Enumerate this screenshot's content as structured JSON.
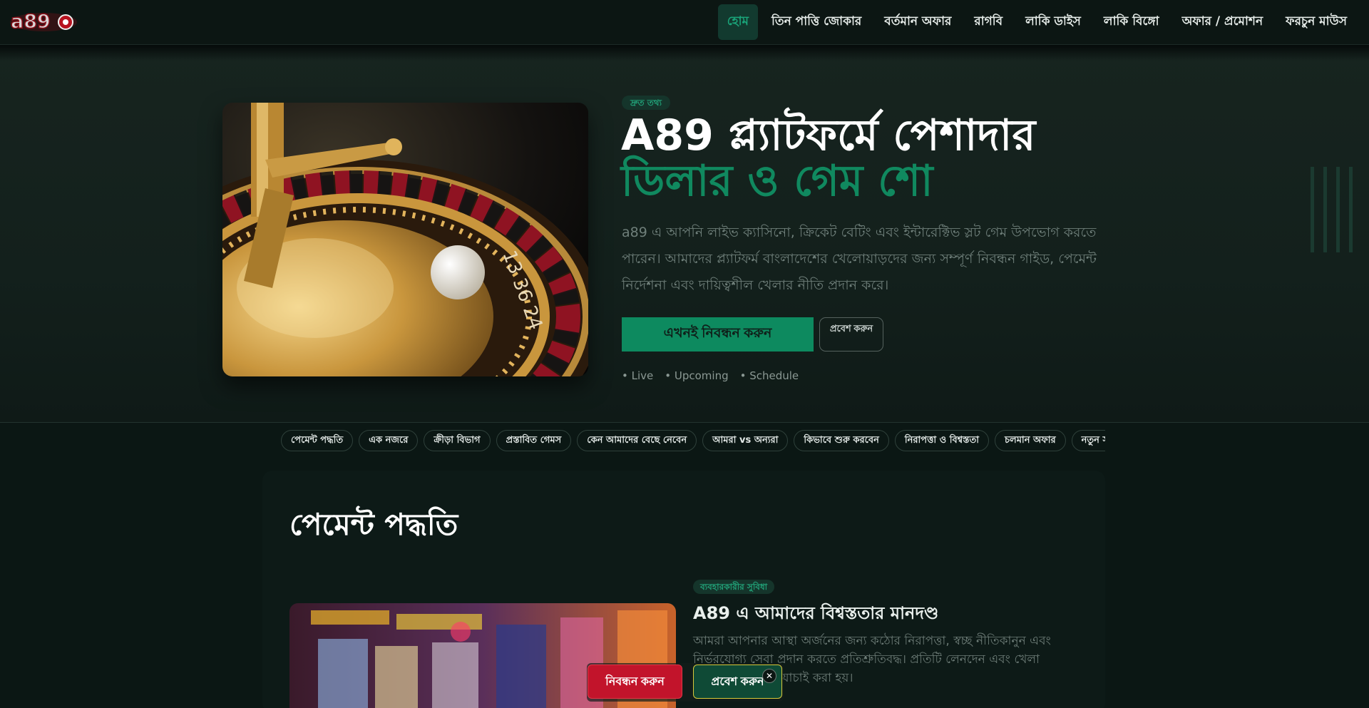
{
  "header": {
    "logo_text": "a89",
    "nav": [
      {
        "label": "হোম",
        "active": true
      },
      {
        "label": "তিন পাত্তি জোকার"
      },
      {
        "label": "বর্তমান অফার"
      },
      {
        "label": "রাগবি"
      },
      {
        "label": "লাকি ডাইস"
      },
      {
        "label": "লাকি বিঙ্গো"
      },
      {
        "label": "অফার / প্রমোশন"
      },
      {
        "label": "ফরচুন মাউস"
      }
    ]
  },
  "hero": {
    "badge": "দ্রুত তথ্য",
    "title_line1": "A89 প্ল্যাটফর্মে পেশাদার",
    "title_line2": "ডিলার ও গেম শো",
    "description": "a89 এ আপনি লাইভ ক্যাসিনো, ক্রিকেট বেটিং এবং ইন্টারেক্টিভ স্লট গেম উপভোগ করতে পারেন। আমাদের প্ল্যাটফর্ম বাংলাদেশের খেলোয়াড়দের জন্য সম্পূর্ণ নিবন্ধন গাইড, পেমেন্ট নির্দেশনা এবং দায়িত্বশীল খেলার নীতি প্রদান করে।",
    "primary_button": "এখনই নিবন্ধন করুন",
    "secondary_button": "প্রবেশ করুন",
    "status_items": [
      "• Live",
      "• Upcoming",
      "• Schedule"
    ]
  },
  "chips": [
    "পেমেন্ট পদ্ধতি",
    "এক নজরে",
    "ক্রীড়া বিভাগ",
    "প্রস্তাবিত গেমস",
    "কেন আমাদের বেছে নেবেন",
    "আমরা vs অন্যরা",
    "কিভাবে শুরু করবেন",
    "নিরাপত্তা ও বিশ্বস্ততা",
    "চলমান অফার",
    "নতুন সদ"
  ],
  "section": {
    "title": "পেমেন্ট পদ্ধতি",
    "badge": "ব্যবহারকারীর সুবিধা",
    "subtitle": "A89 এ আমাদের বিশ্বস্ততার মানদণ্ড",
    "description": "আমরা আপনার আস্থা অর্জনের জন্য কঠোর নিরাপত্তা, স্বচ্ছ নীতিকানুন এবং নির্ভরযোগ্য সেবা প্রদান করতে প্রতিশ্রুতিবদ্ধ। প্রতিটি লেনদেন এবং খেলা আমাদের সিস্টেমে যাচাই করা হয়।"
  },
  "sticky": {
    "register": "নিবন্ধন করুন",
    "login": "প্রবেশ করুন",
    "close": "✕"
  }
}
